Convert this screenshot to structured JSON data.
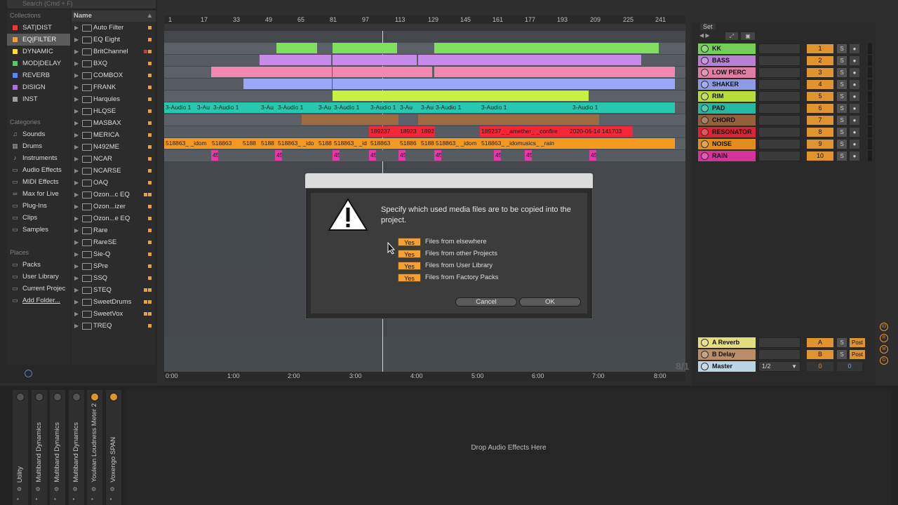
{
  "browser": {
    "search_placeholder": "Search (Cmd + F)",
    "collections_header": "Collections",
    "collections": [
      {
        "label": "SAT|DIST",
        "color": "#e23b3b"
      },
      {
        "label": "EQ|FILTER",
        "color": "#f5a032"
      },
      {
        "label": "DYNAMIC",
        "color": "#f0e040"
      },
      {
        "label": "MOD|DELAY",
        "color": "#58c860"
      },
      {
        "label": "REVERB",
        "color": "#5a8af0"
      },
      {
        "label": "DISIGN",
        "color": "#b070e0"
      },
      {
        "label": "INST",
        "color": "#a0a0a0"
      }
    ],
    "categories_header": "Categories",
    "categories": [
      "Sounds",
      "Drums",
      "Instruments",
      "Audio Effects",
      "MIDI Effects",
      "Max for Live",
      "Plug-Ins",
      "Clips",
      "Samples"
    ],
    "places_header": "Places",
    "places": [
      "Packs",
      "User Library",
      "Current Projec",
      "Add Folder..."
    ],
    "name_header": "Name",
    "items": [
      {
        "name": "Auto Filter",
        "dots": 1
      },
      {
        "name": "EQ Eight",
        "dots": 1
      },
      {
        "name": "BritChannel",
        "dots": 2,
        "red": true
      },
      {
        "name": "BXQ",
        "dots": 1
      },
      {
        "name": "COMBOX",
        "dots": 1
      },
      {
        "name": "FRANK",
        "dots": 1
      },
      {
        "name": "Harqules",
        "dots": 1
      },
      {
        "name": "HLQSE",
        "dots": 1
      },
      {
        "name": "MASBAX",
        "dots": 1
      },
      {
        "name": "MERICA",
        "dots": 1
      },
      {
        "name": "N492ME",
        "dots": 1
      },
      {
        "name": "NCAR",
        "dots": 1
      },
      {
        "name": "NCARSE",
        "dots": 1
      },
      {
        "name": "OAQ",
        "dots": 1
      },
      {
        "name": "Ozon...c EQ",
        "dots": 2
      },
      {
        "name": "Ozon...izer",
        "dots": 1
      },
      {
        "name": "Ozon...e EQ",
        "dots": 1
      },
      {
        "name": "Rare",
        "dots": 1
      },
      {
        "name": "RareSE",
        "dots": 1
      },
      {
        "name": "Sie-Q",
        "dots": 1
      },
      {
        "name": "SPre",
        "dots": 1
      },
      {
        "name": "SSQ",
        "dots": 1
      },
      {
        "name": "STEQ",
        "dots": 2
      },
      {
        "name": "SweetDrums",
        "dots": 2
      },
      {
        "name": "SweetVox",
        "dots": 2
      },
      {
        "name": "TREQ",
        "dots": 1
      }
    ]
  },
  "ruler": {
    "bars": [
      "1",
      "17",
      "33",
      "49",
      "65",
      "81",
      "97",
      "113",
      "129",
      "145",
      "161",
      "177",
      "193",
      "209",
      "225",
      "241"
    ],
    "times": [
      "0:00",
      "1:00",
      "2:00",
      "3:00",
      "4:00",
      "5:00",
      "6:00",
      "7:00",
      "8:00"
    ],
    "corner": "8/1"
  },
  "clips": {
    "audio_label": "3-Audio 1",
    "audio_short": "3-Au",
    "res_a": "189237",
    "res_b": "18923",
    "res_c": "1892",
    "res_d": "189237_ _amether_ _confire",
    "res_e": "2020-06-14 141703",
    "noise_a": "518863_ _idom",
    "noise_b": "518863",
    "noise_c": "5188",
    "noise_d": "518863_ _ido",
    "noise_e": "518863_ _id",
    "noise_f": "51886",
    "noise_g": "518863_ _idomusics_ _rain",
    "rain": "45"
  },
  "mixer": {
    "set_label": "Set",
    "tracks": [
      {
        "name": "KK",
        "color": "#7fe060",
        "num": "1"
      },
      {
        "name": "BASS",
        "color": "#c88ae8",
        "num": "2"
      },
      {
        "name": "LOW PERC",
        "color": "#f288b0",
        "num": "3"
      },
      {
        "name": "SHAKER",
        "color": "#9aa8f8",
        "num": "4"
      },
      {
        "name": "RIM",
        "color": "#c8f040",
        "num": "5"
      },
      {
        "name": "PAD",
        "color": "#28c8b0",
        "num": "6"
      },
      {
        "name": "CHORD",
        "color": "#a06a40",
        "num": "7"
      },
      {
        "name": "RESONATOR",
        "color": "#f02838",
        "num": "8"
      },
      {
        "name": "NOISE",
        "color": "#f59a20",
        "num": "9"
      },
      {
        "name": "RAIN",
        "color": "#e838a8",
        "num": "10"
      }
    ],
    "returns": [
      {
        "name": "A Reverb",
        "color": "#f8f088",
        "num": "A",
        "post": "Post"
      },
      {
        "name": "B Delay",
        "color": "#c89a70",
        "num": "B",
        "post": "Post"
      }
    ],
    "master": {
      "name": "Master",
      "color": "#cce8f8",
      "input": "1/2",
      "vol": "0",
      "pan": "0"
    },
    "solo": "S"
  },
  "devices": [
    {
      "name": "Utility",
      "on": false
    },
    {
      "name": "Multiband Dynamics",
      "on": false
    },
    {
      "name": "Multiband Dynamics",
      "on": false
    },
    {
      "name": "Multiband Dynamics",
      "on": false
    },
    {
      "name": "Youlean Loudness Meter 2",
      "on": true
    },
    {
      "name": "Voxengo SPAN",
      "on": true
    }
  ],
  "device_drop": "Drop Audio Effects Here",
  "dialog": {
    "message": "Specify which used media files are to be copied into the project.",
    "options": [
      {
        "value": "Yes",
        "label": "Files from elsewhere"
      },
      {
        "value": "Yes",
        "label": "Files from other Projects"
      },
      {
        "value": "Yes",
        "label": "Files from User Library"
      },
      {
        "value": "Yes",
        "label": "Files from Factory Packs"
      }
    ],
    "cancel": "Cancel",
    "ok": "OK"
  }
}
